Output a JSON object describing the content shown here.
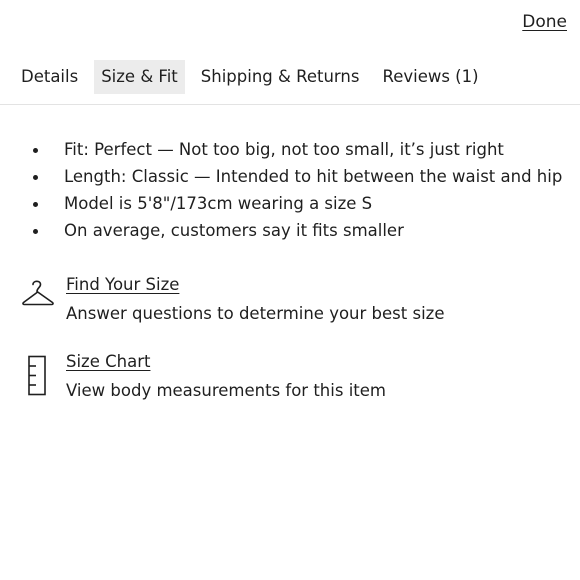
{
  "header": {
    "done_label": "Done"
  },
  "tabs": [
    {
      "label": "Details",
      "active": false
    },
    {
      "label": "Size & Fit",
      "active": true
    },
    {
      "label": "Shipping & Returns",
      "active": false
    },
    {
      "label": "Reviews (1)",
      "active": false
    }
  ],
  "fit_details": [
    "Fit: Perfect — Not too big, not too small, it’s just right",
    "Length: Classic — Intended to hit between the waist and hip",
    "Model is 5'8\"/173cm wearing a size S",
    "On average, customers say it fits smaller"
  ],
  "tools": {
    "find_your_size": {
      "icon": "hanger-icon",
      "link": "Find Your Size",
      "description": "Answer questions to determine your best size"
    },
    "size_chart": {
      "icon": "ruler-icon",
      "link": "Size Chart",
      "description": "View body measurements for this item"
    }
  },
  "colors": {
    "text": "#1f1f1f",
    "active_tab_bg": "#ececec",
    "divider": "#e3e3e3"
  }
}
